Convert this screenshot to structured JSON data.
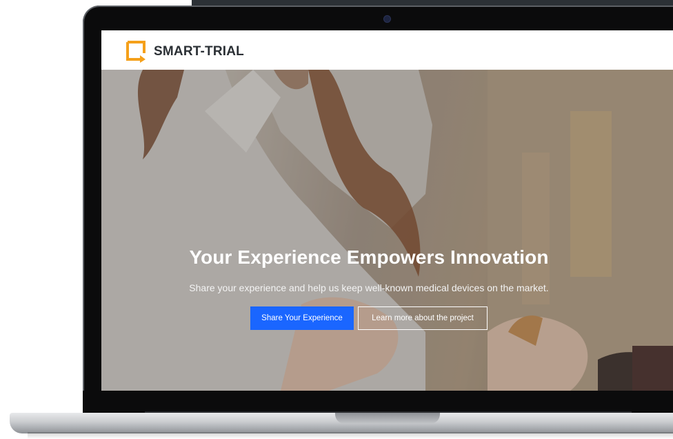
{
  "brand": {
    "name": "SMART-TRIAL",
    "accent_color": "#f5a01a",
    "logo_icon": "smart-trial-logo-icon"
  },
  "hero": {
    "title": "Your Experience Empowers Innovation",
    "subtitle": "Share your experience and help us keep well-known medical devices on the market.",
    "primary_button": "Share Your Experience",
    "secondary_button": "Learn more about the project",
    "primary_color": "#1a66ff"
  }
}
